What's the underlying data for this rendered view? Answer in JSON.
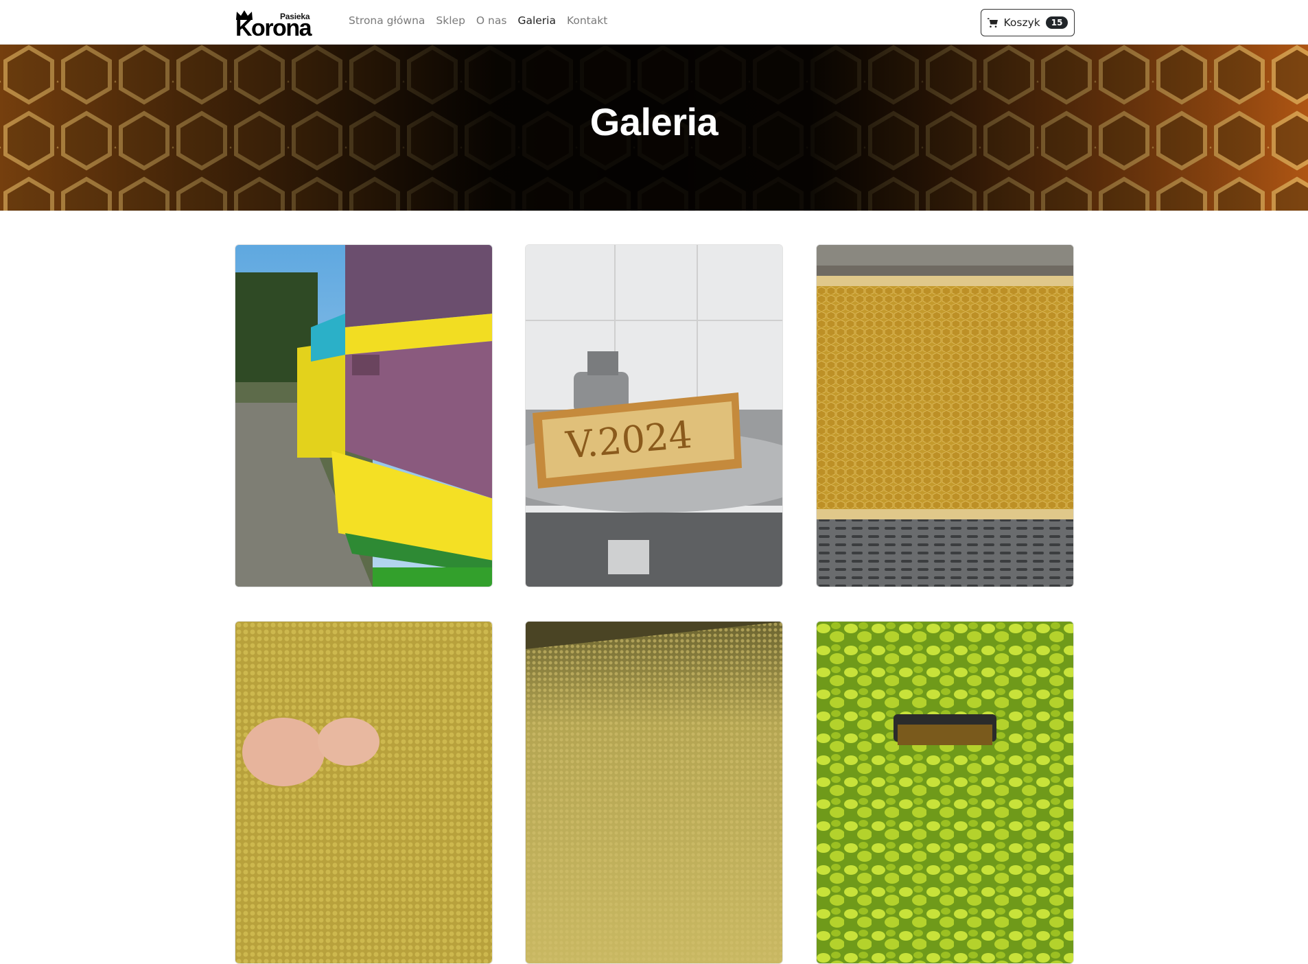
{
  "brand": {
    "small": "Pasieka",
    "main": "Korona"
  },
  "nav": {
    "links": [
      "Strona główna",
      "Sklep",
      "O nas",
      "Galeria",
      "Kontakt"
    ],
    "active": "Galeria"
  },
  "cart": {
    "label": "Koszyk",
    "count": "15",
    "icon": "cart-icon"
  },
  "hero": {
    "title": "Galeria"
  },
  "gallery": {
    "images": [
      "beehives-row",
      "honey-frame-v2024",
      "honeycomb-frame",
      "bee-pollen-hand",
      "bee-pollen-pile",
      "honey-jar-in-bush"
    ],
    "frame_inscription": "V.2024"
  },
  "colors": {
    "accent": "#212529",
    "nav_text": "#7a7a7a",
    "nav_active": "#222222"
  }
}
